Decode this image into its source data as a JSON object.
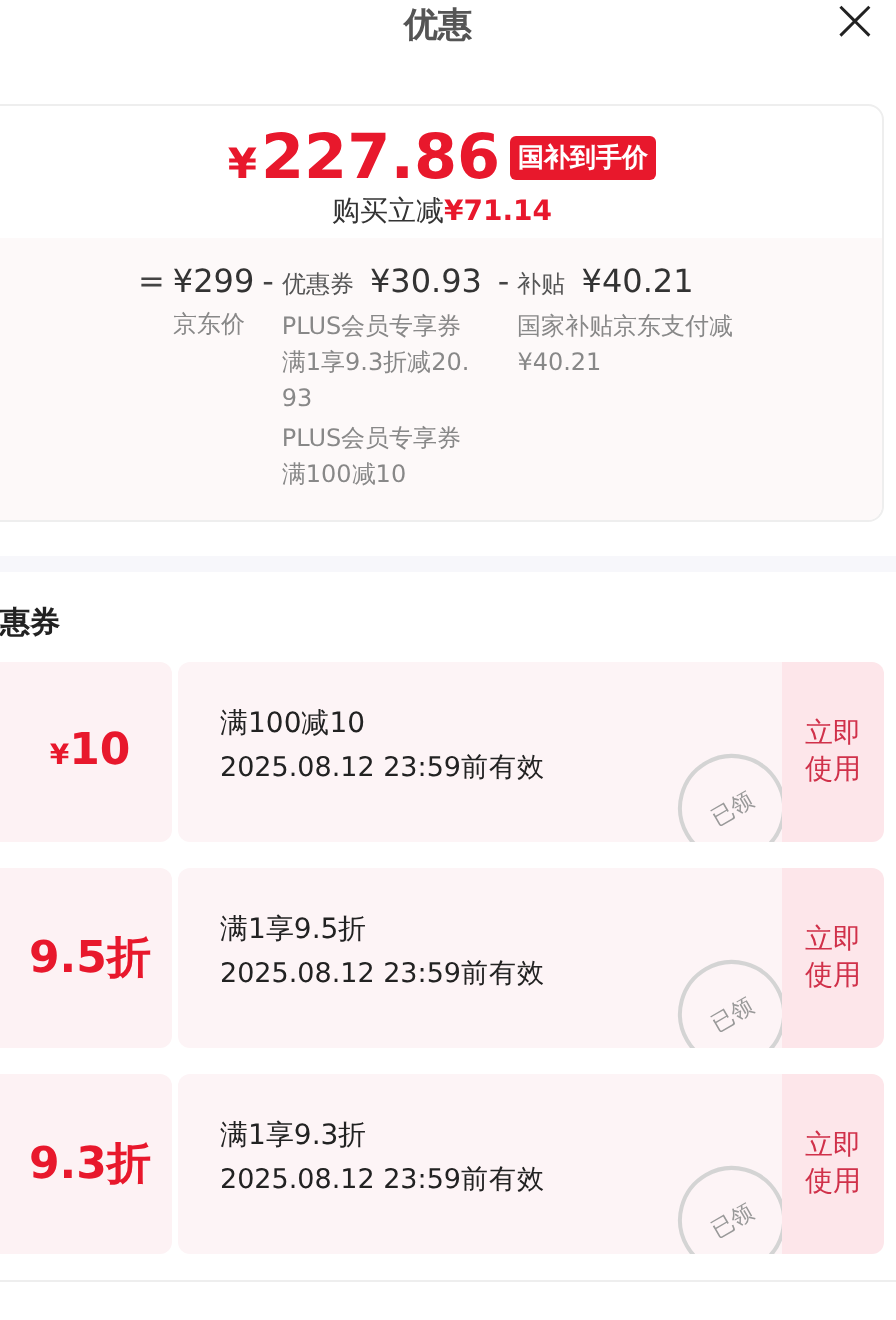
{
  "header": {
    "title": "优惠",
    "close": "×"
  },
  "price_card": {
    "currency": "¥",
    "price": "227.86",
    "badge": "国补到手价",
    "saving_label": "购买立减",
    "saving": "¥71.14",
    "terms": [
      {
        "op": "=",
        "amount": "¥299",
        "notes": [
          "京东价"
        ]
      },
      {
        "op": "-",
        "label": "优惠券",
        "amount": "¥30.93",
        "notes": [
          "PLUS会员专享券满1享9.3折减20.93",
          "PLUS会员专享券满100减10"
        ]
      },
      {
        "op": "-",
        "label": "补贴",
        "amount": "¥40.21",
        "notes": [
          "国家补贴京东支付减¥40.21"
        ]
      }
    ]
  },
  "section_title": "惠券",
  "coupons": [
    {
      "currency": "¥",
      "value": "10",
      "rule": "满100减10",
      "validity": "2025.08.12 23:59前有效",
      "stamp": "已领",
      "action": "立即使用"
    },
    {
      "value": "9.5折",
      "rule": "满1享9.5折",
      "validity": "2025.08.12 23:59前有效",
      "stamp": "已领",
      "action": "立即使用"
    },
    {
      "value": "9.3折",
      "rule": "满1享9.3折",
      "validity": "2025.08.12 23:59前有效",
      "stamp": "已领",
      "action": "立即使用"
    }
  ]
}
